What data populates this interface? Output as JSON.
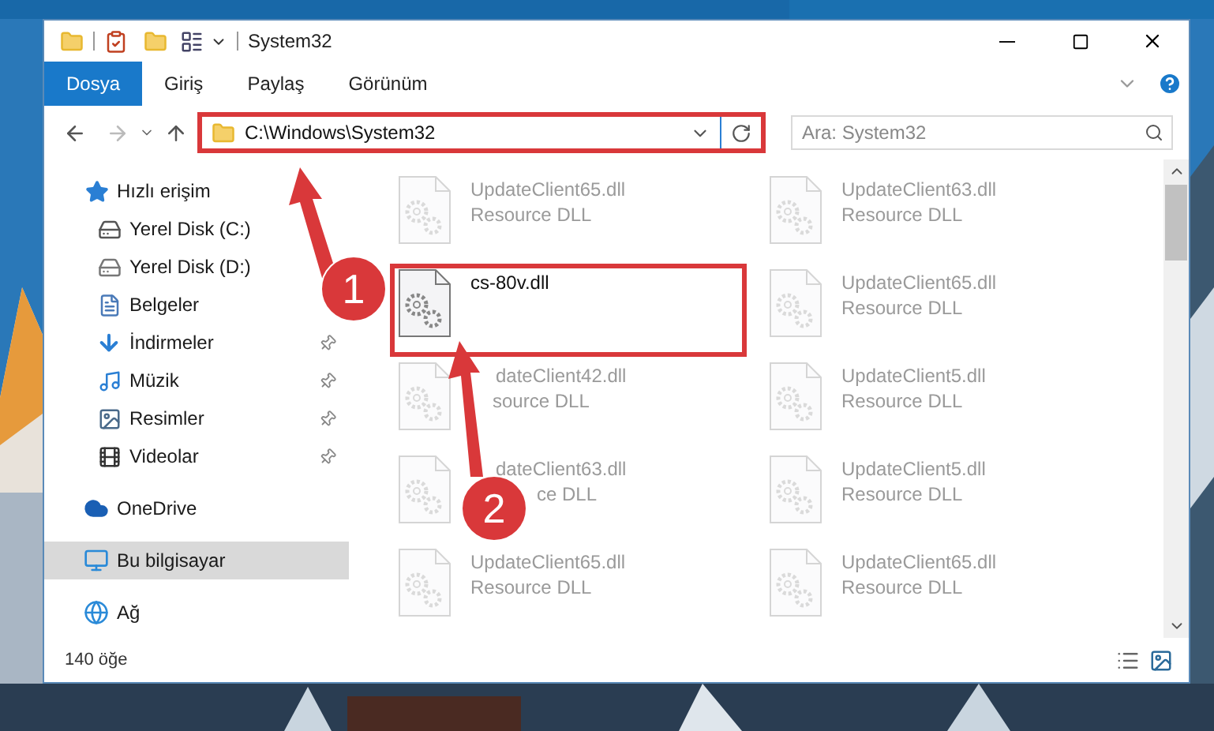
{
  "window": {
    "title": "System32"
  },
  "ribbon_tabs": [
    {
      "label": "Dosya",
      "selected": true
    },
    {
      "label": "Giriş",
      "selected": false
    },
    {
      "label": "Paylaş",
      "selected": false
    },
    {
      "label": "Görünüm",
      "selected": false
    }
  ],
  "address_bar": {
    "path": "C:\\Windows\\System32",
    "highlighted": true
  },
  "search": {
    "placeholder": "Ara: System32"
  },
  "sidebar": {
    "items": [
      {
        "label": "Hızlı erişim",
        "kind": "quick",
        "selected": false,
        "children": [
          {
            "label": "Yerel Disk (C:)",
            "kind": "drive-c",
            "pinned": false
          },
          {
            "label": "Yerel Disk (D:)",
            "kind": "drive",
            "pinned": false
          },
          {
            "label": "Belgeler",
            "kind": "documents",
            "pinned": false
          },
          {
            "label": "İndirmeler",
            "kind": "downloads",
            "pinned": true
          },
          {
            "label": "Müzik",
            "kind": "music",
            "pinned": true
          },
          {
            "label": "Resimler",
            "kind": "pictures",
            "pinned": true
          },
          {
            "label": "Videolar",
            "kind": "videos",
            "pinned": true
          }
        ]
      },
      {
        "label": "OneDrive",
        "kind": "cloud",
        "selected": false
      },
      {
        "label": "Bu bilgisayar",
        "kind": "computer",
        "selected": true
      },
      {
        "label": "Ağ",
        "kind": "network",
        "selected": false
      }
    ]
  },
  "files": [
    {
      "name": "UpdateClient65.dll",
      "type": "Resource DLL",
      "dimmed": true,
      "highlighted": false
    },
    {
      "name": "UpdateClient63.dll",
      "type": "Resource DLL",
      "dimmed": true,
      "highlighted": false
    },
    {
      "name": "cs-80v.dll",
      "dimmed": false,
      "highlighted": true
    },
    {
      "name": "UpdateClient65.dll",
      "type": "Resource DLL",
      "dimmed": true,
      "highlighted": false
    },
    {
      "name": "dateClient42.dll",
      "type": "source DLL",
      "dimmed": true,
      "highlighted": false
    },
    {
      "name": "UpdateClient5.dll",
      "type": "Resource DLL",
      "dimmed": true,
      "highlighted": false
    },
    {
      "name": "dateClient63.dll",
      "type": "ce DLL",
      "dimmed": true,
      "highlighted": false
    },
    {
      "name": "UpdateClient5.dll",
      "type": "Resource DLL",
      "dimmed": true,
      "highlighted": false
    },
    {
      "name": "UpdateClient65.dll",
      "type": "Resource DLL",
      "dimmed": true,
      "highlighted": false
    },
    {
      "name": "UpdateClient65.dll",
      "type": "Resource DLL",
      "dimmed": true,
      "highlighted": false
    }
  ],
  "status_bar": {
    "item_count": "140 öğe"
  },
  "callouts": [
    {
      "label": "1"
    },
    {
      "label": "2"
    }
  ]
}
